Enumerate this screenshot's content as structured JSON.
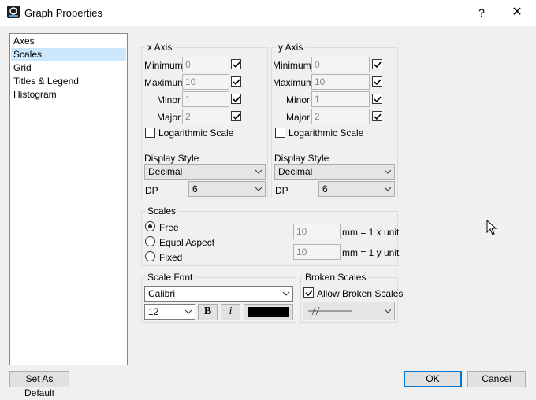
{
  "window": {
    "title": "Graph Properties",
    "help": "?",
    "close": "✕"
  },
  "sidebar": {
    "items": [
      {
        "label": "Axes"
      },
      {
        "label": "Scales"
      },
      {
        "label": "Grid"
      },
      {
        "label": "Titles & Legend"
      },
      {
        "label": "Histogram"
      }
    ],
    "selected": "Scales"
  },
  "x_axis": {
    "title": "x Axis",
    "minimum_label": "Minimum",
    "minimum": "0",
    "maximum_label": "Maximum",
    "maximum": "10",
    "minor_label": "Minor",
    "minor": "1",
    "major_label": "Major",
    "major": "2",
    "log_label": "Logarithmic Scale",
    "display_style_label": "Display Style",
    "display_style": "Decimal",
    "dp_label": "DP",
    "dp": "6"
  },
  "y_axis": {
    "title": "y Axis",
    "minimum_label": "Minimum",
    "minimum": "0",
    "maximum_label": "Maximum",
    "maximum": "10",
    "minor_label": "Minor",
    "minor": "1",
    "major_label": "Major",
    "major": "2",
    "log_label": "Logarithmic Scale",
    "display_style_label": "Display Style",
    "display_style": "Decimal",
    "dp_label": "DP",
    "dp": "6"
  },
  "scales": {
    "title": "Scales",
    "free": "Free",
    "equal_aspect": "Equal Aspect",
    "fixed": "Fixed",
    "x_mm": "10",
    "x_unit": "mm = 1 x unit",
    "y_mm": "10",
    "y_unit": "mm = 1 y unit"
  },
  "scale_font": {
    "title": "Scale Font",
    "font": "Calibri",
    "size": "12",
    "bold": "B",
    "italic": "i",
    "color": "#000000"
  },
  "broken_scales": {
    "title": "Broken Scales",
    "allow_label": "Allow Broken Scales"
  },
  "buttons": {
    "set_default": "Set As Default",
    "ok": "OK",
    "cancel": "Cancel"
  }
}
